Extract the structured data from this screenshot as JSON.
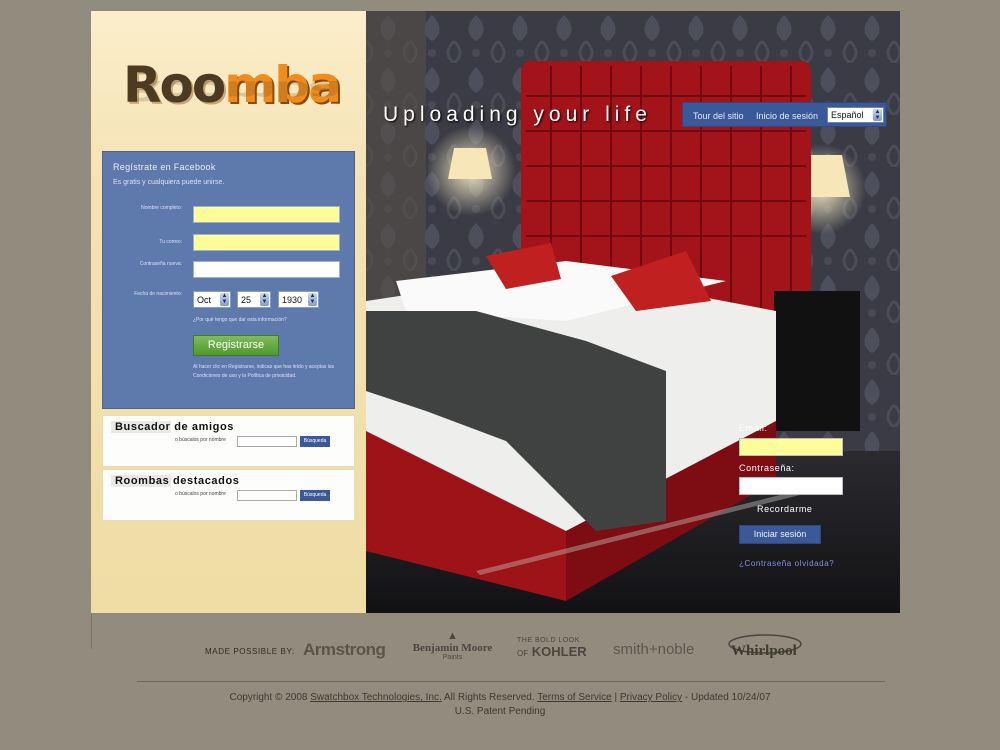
{
  "brand": {
    "logo_text": "Roomba"
  },
  "header": {
    "tagline": "Uploading your life",
    "nav": {
      "tour": "Tour del sitio",
      "login": "Inicio de sesión",
      "language": "Español"
    }
  },
  "register": {
    "title": "Regístrate en Facebook",
    "subtitle": "Es gratis y cualquiera puede unirse.",
    "labels": {
      "name": "Nombre completo:",
      "email": "Tu correo:",
      "password": "Contraseña nueva:",
      "birthday": "Fecha de nacimiento:"
    },
    "birthday": {
      "month": "Oct",
      "day": "25",
      "year": "1930"
    },
    "hint": "¿Por qué tengo que dar esta información?",
    "button": "Registrarse",
    "terms": "Al hacer clic en Registrarse, indicas que has leído y aceptas las Condiciones de uso y la Política de privacidad."
  },
  "friend_finder": {
    "title": "Buscador de amigos",
    "search_hint": "o búscalos por nombre",
    "button": "Búsqueda"
  },
  "featured": {
    "title": "Roombas destacados",
    "search_hint": "o búscalos por nombre",
    "button": "Búsqueda"
  },
  "login": {
    "email_label": "Email:",
    "password_label": "Contraseña:",
    "remember": "Recordarme",
    "button": "Iniciar sesión",
    "forgot": "¿Contraseña olvidada?"
  },
  "footer": {
    "made_by": "MADE POSSIBLE BY:",
    "sponsors": {
      "armstrong": "Armstrong",
      "bm_top": "Benjamin Moore",
      "bm_bottom": "Paints",
      "kohler_top": "THE BOLD LOOK",
      "kohler_of": "OF",
      "kohler": "KOHLER",
      "smith": "smith+noble",
      "whirlpool": "Whirlpool"
    },
    "copyright_prefix": "Copyright © 2008",
    "company": "Swatchbox Technologies, Inc.",
    "rights": "All Rights Reserved.",
    "terms": "Terms of Service",
    "sep": "|",
    "privacy": "Privacy Policy",
    "updated": "- Updated 10/24/07",
    "patent": "U.S. Patent Pending"
  },
  "colors": {
    "background": "#928c7e",
    "fb_blue": "#3b5998",
    "panel_blue": "#5e79ac",
    "field_yellow": "#fffc9a",
    "brand_orange": "#f08c1c",
    "headboard_red": "#b3161c"
  }
}
